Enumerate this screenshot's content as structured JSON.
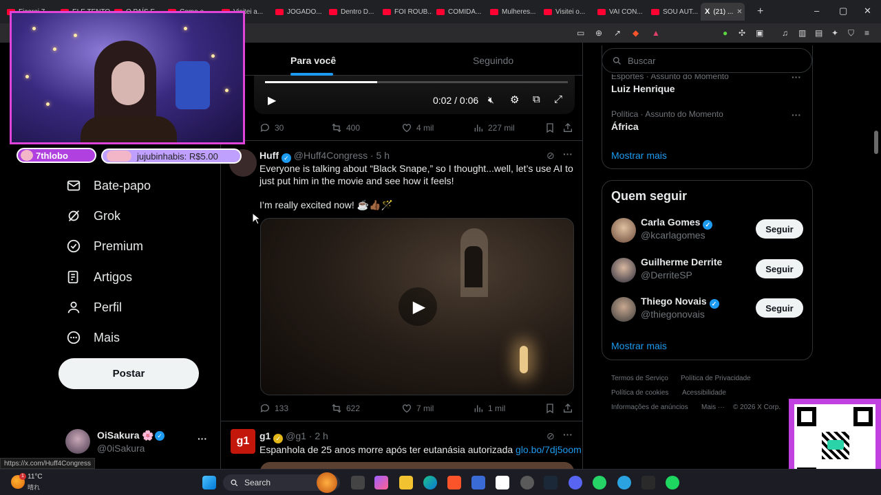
{
  "browser": {
    "tabs": [
      {
        "label": "Ficarei 7..."
      },
      {
        "label": "ELE TENTO..."
      },
      {
        "label": "O PAÍS E..."
      },
      {
        "label": "Como o..."
      },
      {
        "label": "Visitei a..."
      },
      {
        "label": "JOGADO..."
      },
      {
        "label": "Dentro D..."
      },
      {
        "label": "FOI ROUB..."
      },
      {
        "label": "COMIDA..."
      },
      {
        "label": "Mulheres..."
      },
      {
        "label": "Visitei o..."
      },
      {
        "label": "VAI CON..."
      },
      {
        "label": "SOU AUT..."
      }
    ],
    "active_tab": {
      "icon": "X",
      "label": "(21) ..."
    },
    "status_url": "https://x.com/Huff4Congress"
  },
  "overlay": {
    "badge_left": "7thlobo",
    "badge_right": "jujubinhabis: R$5.00"
  },
  "nav": {
    "items": [
      {
        "label": "Bate-papo",
        "icon": "mail-icon"
      },
      {
        "label": "Grok",
        "icon": "grok-icon"
      },
      {
        "label": "Premium",
        "icon": "verified-badge-icon"
      },
      {
        "label": "Artigos",
        "icon": "article-icon"
      },
      {
        "label": "Perfil",
        "icon": "person-icon"
      },
      {
        "label": "Mais",
        "icon": "more-circle-icon"
      }
    ],
    "post_label": "Postar",
    "account": {
      "name": "OiSakura 🌸",
      "handle": "@0iSakura"
    }
  },
  "feed": {
    "tab_for_you": "Para você",
    "tab_following": "Seguindo",
    "video1": {
      "time": "0:02 / 0:06",
      "progress": 0.37
    },
    "tweet1_stats": {
      "replies": "30",
      "reposts": "400",
      "likes": "4 mil",
      "views": "227 mil"
    },
    "tweet2": {
      "name": "Huff",
      "handle": "@Huff4Congress · 5 h",
      "text1": "Everyone is talking about “Black Snape,” so I thought...well, let’s use AI to just put him in the movie and see how it feels!",
      "text2": "I’m really excited now! ☕👍🏾🪄",
      "stats": {
        "replies": "133",
        "reposts": "622",
        "likes": "7 mil",
        "views": "1 mil"
      }
    },
    "tweet3": {
      "avatar_text": "g1",
      "name": "g1",
      "handle": "@g1 · 2 h",
      "text": "Espanhola de 25 anos morre após ter eutanásia autorizada",
      "link": "glo.bo/7dj5oom"
    }
  },
  "sidebar": {
    "search_placeholder": "Buscar",
    "trends": [
      {
        "meta": "Esportes · Assunto do Momento",
        "title": "Luiz Henrique"
      },
      {
        "meta": "Política · Assunto do Momento",
        "title": "África"
      }
    ],
    "trends_more": "Mostrar mais",
    "who_to_follow_title": "Quem seguir",
    "follow": [
      {
        "name": "Carla Gomes",
        "handle": "@kcarlagomes",
        "verified": true
      },
      {
        "name": "Guilherme Derrite",
        "handle": "@DerriteSP",
        "verified": false
      },
      {
        "name": "Thiego Novais",
        "handle": "@thiegonovais",
        "verified": true
      }
    ],
    "follow_button": "Seguir",
    "follow_more": "Mostrar mais",
    "footer": [
      "Termos de Serviço",
      "Política de Privacidade",
      "Política de cookies",
      "Acessibilidade",
      "Informações de anúncios",
      "Mais ···",
      "© 2026 X Corp."
    ]
  },
  "taskbar": {
    "weather_temp": "11°C",
    "weather_desc": "晴れ",
    "search_label": "Search",
    "notification_count": "1"
  },
  "colors": {
    "accent": "#1d9bf0",
    "overlay_border": "#e044d8",
    "background": "#000000"
  }
}
